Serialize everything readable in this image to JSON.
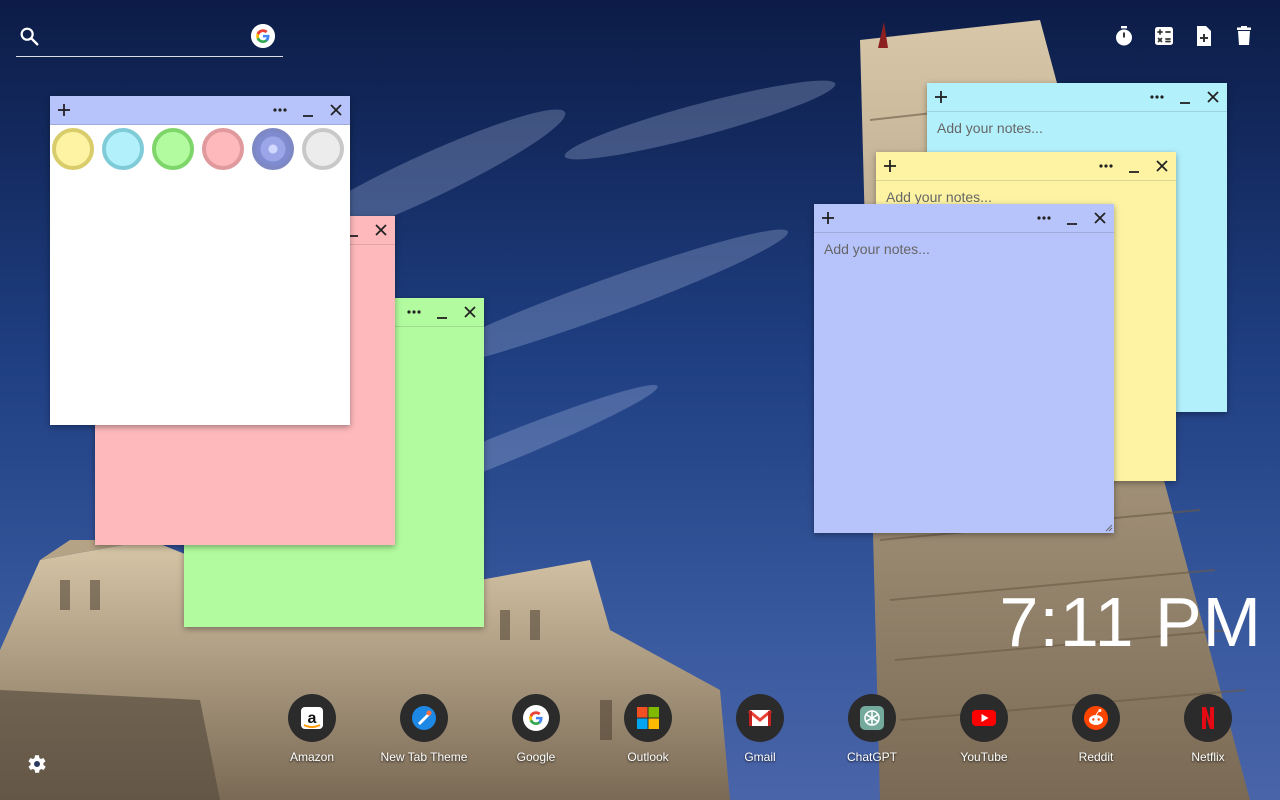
{
  "search": {
    "placeholder": "",
    "value": ""
  },
  "toolbar": {
    "timer_icon": "timer-icon",
    "calculator_icon": "calculator-icon",
    "add_note_icon": "add-note-icon",
    "delete_icon": "trash-icon"
  },
  "notes": {
    "placeholder": "Add your notes...",
    "colors": {
      "yellow": "#fdf3a3",
      "cyan": "#b2f1fc",
      "green": "#b2fb9f",
      "pink": "#feb9bc",
      "periwinkle": "#b7c3fb",
      "white": "#ffffff"
    },
    "header_buttons": {
      "add": "+",
      "more": "•••",
      "minimize": "_",
      "close": "✕"
    }
  },
  "clock": {
    "time": "7:11 PM"
  },
  "shortcuts": [
    {
      "label": "Amazon",
      "icon": "amazon-icon"
    },
    {
      "label": "New Tab Theme",
      "icon": "new-tab-theme-icon"
    },
    {
      "label": "Google",
      "icon": "google-icon"
    },
    {
      "label": "Outlook",
      "icon": "outlook-icon"
    },
    {
      "label": "Gmail",
      "icon": "gmail-icon"
    },
    {
      "label": "ChatGPT",
      "icon": "chatgpt-icon"
    },
    {
      "label": "YouTube",
      "icon": "youtube-icon"
    },
    {
      "label": "Reddit",
      "icon": "reddit-icon"
    },
    {
      "label": "Netflix",
      "icon": "netflix-icon"
    }
  ]
}
